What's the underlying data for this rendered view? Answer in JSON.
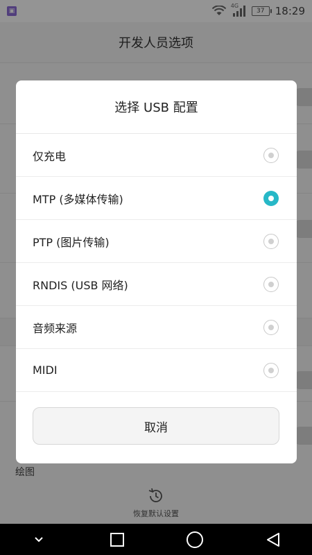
{
  "status_bar": {
    "network_type": "4G",
    "battery_level": "37",
    "time": "18:29"
  },
  "app_bar": {
    "title": "开发人员选项"
  },
  "background": {
    "section_label": "绘图",
    "restore_label": "恢复默认设置"
  },
  "dialog": {
    "title": "选择 USB 配置",
    "options": [
      {
        "label": "仅充电",
        "selected": false
      },
      {
        "label": "MTP (多媒体传输)",
        "selected": true
      },
      {
        "label": "PTP (图片传输)",
        "selected": false
      },
      {
        "label": "RNDIS (USB 网络)",
        "selected": false
      },
      {
        "label": "音频来源",
        "selected": false
      },
      {
        "label": "MIDI",
        "selected": false
      }
    ],
    "cancel_label": "取消"
  },
  "colors": {
    "accent": "#27b8c7"
  },
  "icons": {
    "app_notification": "app-notification-icon",
    "wifi": "wifi-icon",
    "signal": "signal-icon",
    "battery": "battery-icon",
    "restore": "restore-icon",
    "nav_down": "chevron-down-icon",
    "nav_recent": "square-icon",
    "nav_home": "circle-icon",
    "nav_back": "triangle-back-icon"
  }
}
